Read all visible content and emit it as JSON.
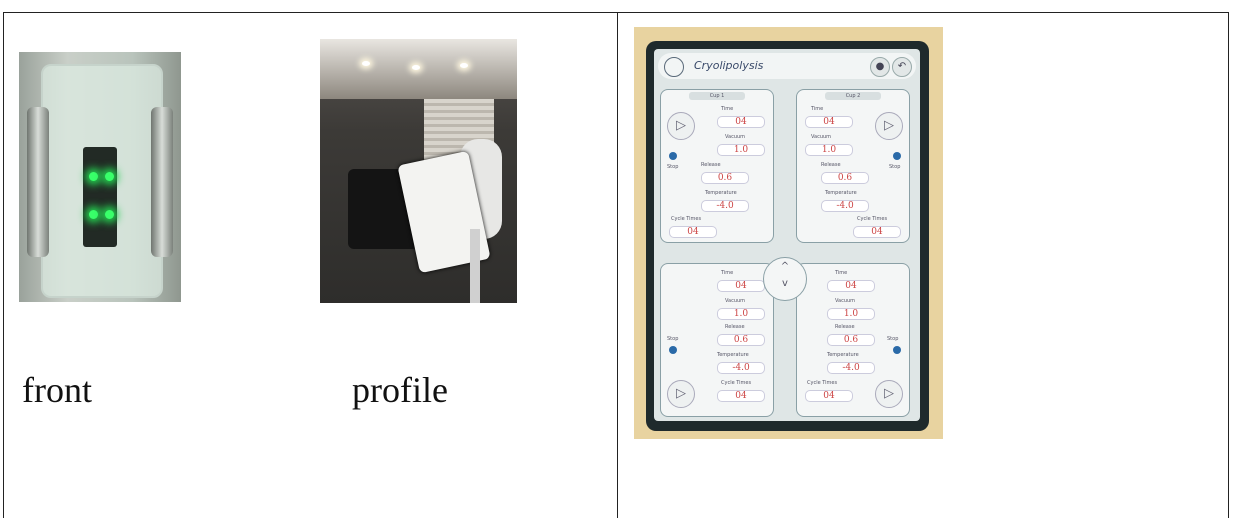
{
  "captions": {
    "front": "front",
    "profile": "profile"
  },
  "tablet": {
    "title": "Cryolipolysis",
    "cup1_label": "Cup 1",
    "cup2_label": "Cup 2",
    "time_label": "Time",
    "vacuum_label": "Vacuum",
    "release_label": "Release",
    "temperature_label": "Temperature",
    "cycle_label": "Cycle Times",
    "stop_label": "Stop",
    "time_value": "04",
    "vacuum_value": "1.0",
    "release_value": "0.6",
    "temperature_value": "-4.0",
    "cycle_value": "04",
    "up_icon": "^",
    "down_icon": "v"
  },
  "colors": {
    "border": "#222222",
    "value_red": "#cc4444",
    "led_green": "#39ff6a"
  }
}
